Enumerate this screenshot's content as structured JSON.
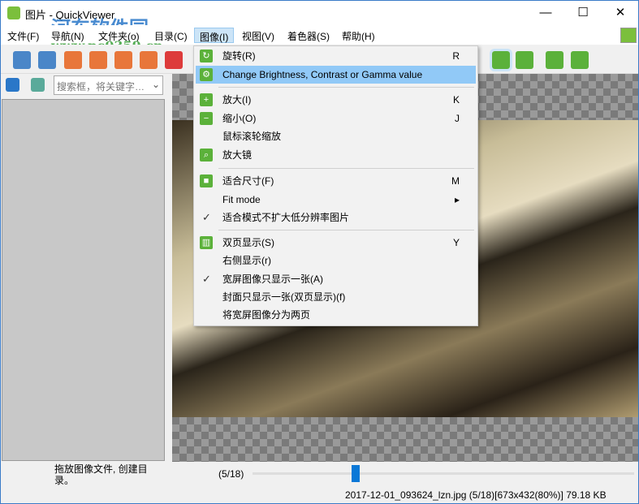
{
  "window": {
    "title": "图片 - QuickViewer",
    "minimize": "—",
    "maximize": "☐",
    "close": "✕"
  },
  "watermark": {
    "line1": "河东软件园",
    "line2": "www.pc0359.cn"
  },
  "menubar": [
    "文件(F)",
    "导航(N)",
    "文件夹(o)",
    "目录(C)",
    "图像(I)",
    "视图(V)",
    "着色器(S)",
    "帮助(H)"
  ],
  "search": {
    "placeholder": "搜索框，将关键字…"
  },
  "menu": {
    "items": [
      {
        "label": "旋转(R)",
        "shortcut": "R",
        "icon": "rotate-icon"
      },
      {
        "label": "Change Brightness, Contrast or Gamma value",
        "shortcut": "",
        "icon": "gear-icon"
      },
      {
        "label": "放大(I)",
        "shortcut": "K",
        "icon": "zoom-in-icon"
      },
      {
        "label": "缩小(O)",
        "shortcut": "J",
        "icon": "zoom-out-icon"
      },
      {
        "label": "鼠标滚轮缩放",
        "shortcut": ""
      },
      {
        "label": "放大镜",
        "shortcut": "",
        "icon": "magnifier-icon"
      },
      {
        "label": "适合尺寸(F)",
        "shortcut": "M",
        "icon": "fit-icon"
      },
      {
        "label": "Fit mode",
        "shortcut": "▸"
      },
      {
        "label": "适合模式不扩大低分辨率图片",
        "shortcut": "",
        "checked": true
      },
      {
        "label": "双页显示(S)",
        "shortcut": "Y",
        "icon": "dual-page-icon"
      },
      {
        "label": "右侧显示(r)",
        "shortcut": ""
      },
      {
        "label": "宽屏图像只显示一张(A)",
        "shortcut": "",
        "checked": true
      },
      {
        "label": "封面只显示一张(双页显示)(f)",
        "shortcut": ""
      },
      {
        "label": "将宽屏图像分为两页",
        "shortcut": ""
      }
    ]
  },
  "status": {
    "hint": "拖放图像文件, 创建目录。",
    "page": "(5/18)",
    "page_fraction": 0.27,
    "file": "2017-12-01_093624_lzn.jpg (5/18)[673x432(80%)] 79.18 KB"
  }
}
